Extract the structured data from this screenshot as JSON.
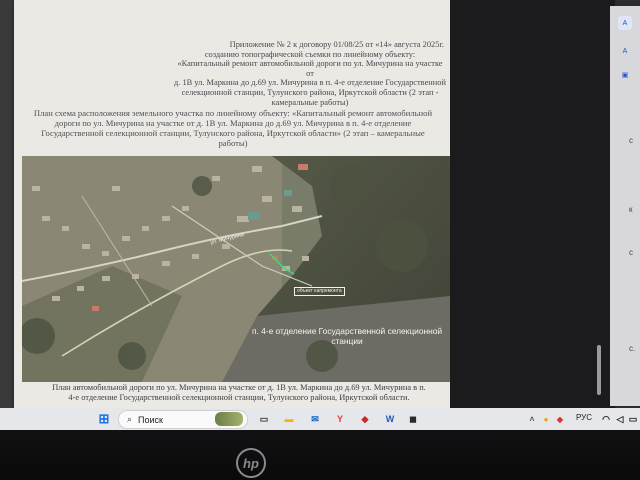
{
  "document": {
    "appendix_lines": [
      "Приложение № 2 к договору 01/08/25 от «14» августа 2025г.",
      "созданию топографической съемки по линейному объекту:",
      "«Капитальный ремонт автомобильной дороги по ул. Мичурина на участке от",
      "д. 1В ул. Маркина до д.69 ул. Мичурина в п. 4-е отделение Государственной",
      "селекционной станции, Тулунского района, Иркутской области (2 этап - камеральные работы)"
    ],
    "plan_title_lines": [
      "План схема расположения земельного участка по линейному объекту: «Капитальный ремонт автомобильной",
      "дороги по ул. Мичурина на участке от  д. 1В ул. Маркина до д.69 ул. Мичурина в п. 4-е отделение",
      "Государственной селекционной станции, Тулунского района, Иркутской области» (2 этап – камеральные",
      "работы)"
    ],
    "map": {
      "settlement_label": "п. 4-е отделение Государственной селекционной станции",
      "street_label": "ул. Мичурина",
      "object_label": "объект капремонта"
    },
    "caption_lines": [
      "План автомобильной дороги по ул. Мичурина на участке от д. 1В ул. Маркина до д.69 ул. Мичурина в п.",
      "4-е отделение Государственной селекционной станции, Тулунского района, Иркутской области."
    ]
  },
  "side_panel": {
    "icons": [
      {
        "name": "translate-icon",
        "glyph": "A"
      },
      {
        "name": "read-aloud-icon",
        "glyph": "A"
      },
      {
        "name": "office-icon",
        "glyph": "▣"
      }
    ],
    "edge_text": [
      "с",
      "к",
      "с",
      "с."
    ]
  },
  "taskbar": {
    "search_placeholder": "Поиск",
    "language": "РУС",
    "apps": [
      {
        "name": "windows-start-icon",
        "glyph": "⊞",
        "color": "#1a73e8"
      },
      {
        "name": "task-view-icon",
        "glyph": "▭",
        "color": "#333333"
      },
      {
        "name": "file-explorer-icon",
        "glyph": "▬",
        "color": "#f2b600"
      },
      {
        "name": "mail-icon",
        "glyph": "✉",
        "color": "#0a64c8"
      },
      {
        "name": "yandex-browser-icon",
        "glyph": "Y",
        "color": "#e53935"
      },
      {
        "name": "security-icon",
        "glyph": "◆",
        "color": "#c62828"
      },
      {
        "name": "word-icon",
        "glyph": "W",
        "color": "#1e5bb8"
      },
      {
        "name": "app-icon",
        "glyph": "◼",
        "color": "#2b2b2b"
      }
    ]
  },
  "bezel": {
    "brand": "hp"
  }
}
